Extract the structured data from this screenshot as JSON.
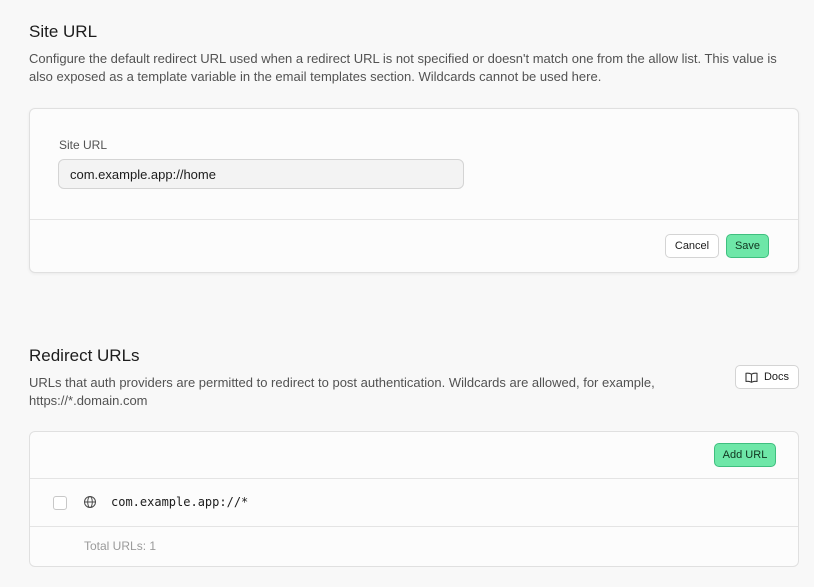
{
  "site_url": {
    "title": "Site URL",
    "description": "Configure the default redirect URL used when a redirect URL is not specified or doesn't match one from the allow list. This value is also exposed as a template variable in the email templates section. Wildcards cannot be used here.",
    "field_label": "Site URL",
    "value": "com.example.app://home",
    "cancel_label": "Cancel",
    "save_label": "Save"
  },
  "redirect_urls": {
    "title": "Redirect URLs",
    "description": "URLs that auth providers are permitted to redirect to post authentication. Wildcards are allowed, for example, https://*.domain.com",
    "docs_label": "Docs",
    "docs_icon": "book-open-icon",
    "add_label": "Add URL",
    "items": [
      {
        "icon": "globe-icon",
        "url": "com.example.app://*"
      }
    ],
    "total_text": "Total URLs: 1"
  },
  "colors": {
    "primary": "#6ee7a8",
    "primary_border": "#3fbf7f",
    "background": "#f8f8f8"
  }
}
